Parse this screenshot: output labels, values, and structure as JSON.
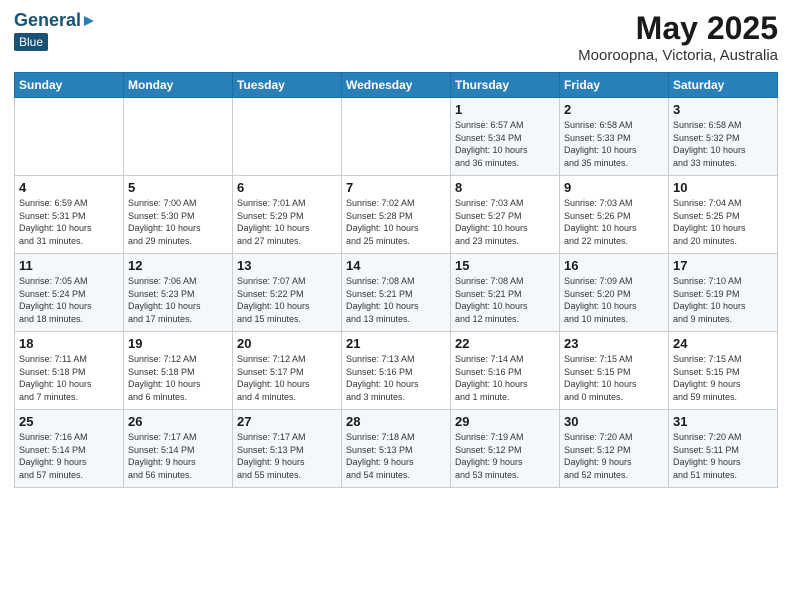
{
  "header": {
    "logo_general": "General",
    "logo_blue": "Blue",
    "title": "May 2025",
    "subtitle": "Mooroopna, Victoria, Australia"
  },
  "days_of_week": [
    "Sunday",
    "Monday",
    "Tuesday",
    "Wednesday",
    "Thursday",
    "Friday",
    "Saturday"
  ],
  "weeks": [
    [
      {
        "day": "",
        "info": ""
      },
      {
        "day": "",
        "info": ""
      },
      {
        "day": "",
        "info": ""
      },
      {
        "day": "",
        "info": ""
      },
      {
        "day": "1",
        "info": "Sunrise: 6:57 AM\nSunset: 5:34 PM\nDaylight: 10 hours\nand 36 minutes."
      },
      {
        "day": "2",
        "info": "Sunrise: 6:58 AM\nSunset: 5:33 PM\nDaylight: 10 hours\nand 35 minutes."
      },
      {
        "day": "3",
        "info": "Sunrise: 6:58 AM\nSunset: 5:32 PM\nDaylight: 10 hours\nand 33 minutes."
      }
    ],
    [
      {
        "day": "4",
        "info": "Sunrise: 6:59 AM\nSunset: 5:31 PM\nDaylight: 10 hours\nand 31 minutes."
      },
      {
        "day": "5",
        "info": "Sunrise: 7:00 AM\nSunset: 5:30 PM\nDaylight: 10 hours\nand 29 minutes."
      },
      {
        "day": "6",
        "info": "Sunrise: 7:01 AM\nSunset: 5:29 PM\nDaylight: 10 hours\nand 27 minutes."
      },
      {
        "day": "7",
        "info": "Sunrise: 7:02 AM\nSunset: 5:28 PM\nDaylight: 10 hours\nand 25 minutes."
      },
      {
        "day": "8",
        "info": "Sunrise: 7:03 AM\nSunset: 5:27 PM\nDaylight: 10 hours\nand 23 minutes."
      },
      {
        "day": "9",
        "info": "Sunrise: 7:03 AM\nSunset: 5:26 PM\nDaylight: 10 hours\nand 22 minutes."
      },
      {
        "day": "10",
        "info": "Sunrise: 7:04 AM\nSunset: 5:25 PM\nDaylight: 10 hours\nand 20 minutes."
      }
    ],
    [
      {
        "day": "11",
        "info": "Sunrise: 7:05 AM\nSunset: 5:24 PM\nDaylight: 10 hours\nand 18 minutes."
      },
      {
        "day": "12",
        "info": "Sunrise: 7:06 AM\nSunset: 5:23 PM\nDaylight: 10 hours\nand 17 minutes."
      },
      {
        "day": "13",
        "info": "Sunrise: 7:07 AM\nSunset: 5:22 PM\nDaylight: 10 hours\nand 15 minutes."
      },
      {
        "day": "14",
        "info": "Sunrise: 7:08 AM\nSunset: 5:21 PM\nDaylight: 10 hours\nand 13 minutes."
      },
      {
        "day": "15",
        "info": "Sunrise: 7:08 AM\nSunset: 5:21 PM\nDaylight: 10 hours\nand 12 minutes."
      },
      {
        "day": "16",
        "info": "Sunrise: 7:09 AM\nSunset: 5:20 PM\nDaylight: 10 hours\nand 10 minutes."
      },
      {
        "day": "17",
        "info": "Sunrise: 7:10 AM\nSunset: 5:19 PM\nDaylight: 10 hours\nand 9 minutes."
      }
    ],
    [
      {
        "day": "18",
        "info": "Sunrise: 7:11 AM\nSunset: 5:18 PM\nDaylight: 10 hours\nand 7 minutes."
      },
      {
        "day": "19",
        "info": "Sunrise: 7:12 AM\nSunset: 5:18 PM\nDaylight: 10 hours\nand 6 minutes."
      },
      {
        "day": "20",
        "info": "Sunrise: 7:12 AM\nSunset: 5:17 PM\nDaylight: 10 hours\nand 4 minutes."
      },
      {
        "day": "21",
        "info": "Sunrise: 7:13 AM\nSunset: 5:16 PM\nDaylight: 10 hours\nand 3 minutes."
      },
      {
        "day": "22",
        "info": "Sunrise: 7:14 AM\nSunset: 5:16 PM\nDaylight: 10 hours\nand 1 minute."
      },
      {
        "day": "23",
        "info": "Sunrise: 7:15 AM\nSunset: 5:15 PM\nDaylight: 10 hours\nand 0 minutes."
      },
      {
        "day": "24",
        "info": "Sunrise: 7:15 AM\nSunset: 5:15 PM\nDaylight: 9 hours\nand 59 minutes."
      }
    ],
    [
      {
        "day": "25",
        "info": "Sunrise: 7:16 AM\nSunset: 5:14 PM\nDaylight: 9 hours\nand 57 minutes."
      },
      {
        "day": "26",
        "info": "Sunrise: 7:17 AM\nSunset: 5:14 PM\nDaylight: 9 hours\nand 56 minutes."
      },
      {
        "day": "27",
        "info": "Sunrise: 7:17 AM\nSunset: 5:13 PM\nDaylight: 9 hours\nand 55 minutes."
      },
      {
        "day": "28",
        "info": "Sunrise: 7:18 AM\nSunset: 5:13 PM\nDaylight: 9 hours\nand 54 minutes."
      },
      {
        "day": "29",
        "info": "Sunrise: 7:19 AM\nSunset: 5:12 PM\nDaylight: 9 hours\nand 53 minutes."
      },
      {
        "day": "30",
        "info": "Sunrise: 7:20 AM\nSunset: 5:12 PM\nDaylight: 9 hours\nand 52 minutes."
      },
      {
        "day": "31",
        "info": "Sunrise: 7:20 AM\nSunset: 5:11 PM\nDaylight: 9 hours\nand 51 minutes."
      }
    ]
  ]
}
